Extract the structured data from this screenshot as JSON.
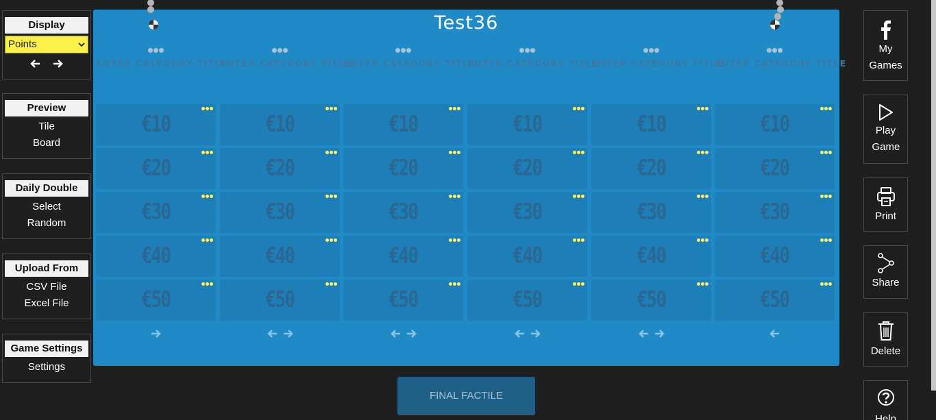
{
  "left": {
    "display": {
      "heading": "Display",
      "select_value": "Points"
    },
    "preview": {
      "heading": "Preview",
      "links": [
        "Tile",
        "Board"
      ]
    },
    "daily_double": {
      "heading": "Daily Double",
      "links": [
        "Select",
        "Random"
      ]
    },
    "upload": {
      "heading": "Upload From",
      "links": [
        "CSV File",
        "Excel File"
      ]
    },
    "settings": {
      "heading": "Game Settings",
      "links": [
        "Settings"
      ]
    }
  },
  "board": {
    "title": "Test36",
    "category_placeholder": "ENTER CATEGORY TITLE",
    "values": [
      "€10",
      "€20",
      "€30",
      "€40",
      "€50"
    ],
    "column_nav": [
      [
        "right"
      ],
      [
        "left",
        "right"
      ],
      [
        "left",
        "right"
      ],
      [
        "left",
        "right"
      ],
      [
        "left",
        "right"
      ],
      [
        "left"
      ]
    ]
  },
  "final_label": "FINAL FACTILE",
  "right": {
    "my_games": "My Games",
    "play_game": "Play Game",
    "print": "Print",
    "share": "Share",
    "delete": "Delete",
    "help": "Help"
  },
  "colors": {
    "board": "#1f8ac6",
    "tile": "#1e7eb7",
    "select": "#fff04a",
    "final": "#1e5f86"
  }
}
